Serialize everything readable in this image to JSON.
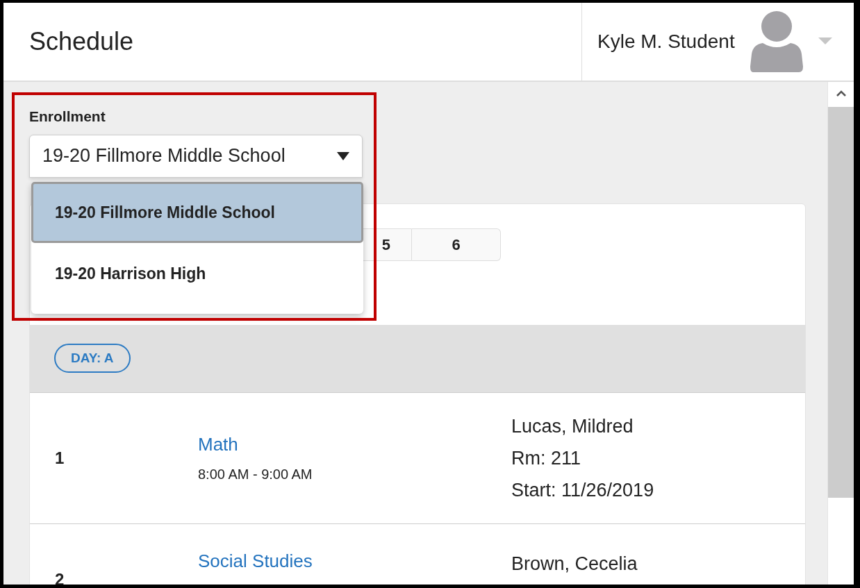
{
  "header": {
    "title": "Schedule",
    "user_name": "Kyle M. Student"
  },
  "enrollment": {
    "label": "Enrollment",
    "value": "19-20 Fillmore Middle School",
    "expanded": true,
    "options": [
      {
        "label": "19-20 Fillmore Middle School",
        "selected": true
      },
      {
        "label": "19-20 Harrison High",
        "selected": false
      }
    ]
  },
  "terms": [
    {
      "label": "5",
      "selected": false
    },
    {
      "label": "6",
      "selected": false
    }
  ],
  "day": "DAY: A",
  "periods": [
    {
      "period": "1",
      "course": "Math",
      "time": "8:00 AM - 9:00 AM",
      "details": [
        "Lucas, Mildred",
        "Rm: 211",
        "Start: 11/26/2019"
      ]
    },
    {
      "period": "2",
      "course": "Social Studies",
      "details": [
        "Brown, Cecelia"
      ]
    }
  ]
}
